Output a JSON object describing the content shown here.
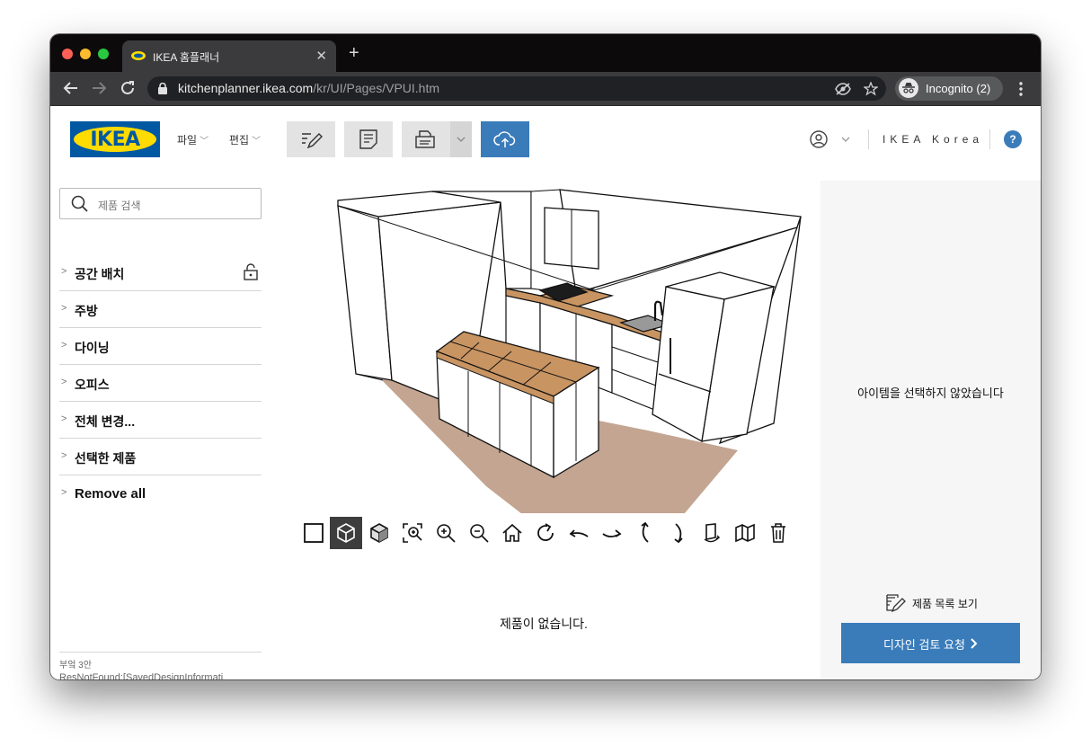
{
  "browser": {
    "tab_title": "IKEA 홈플래너",
    "tab_close": "✕",
    "new_tab": "+",
    "url_host": "kitchenplanner.ikea.com",
    "url_path": "/kr/UI/Pages/VPUI.htm",
    "incognito_label": "Incognito (2)"
  },
  "header": {
    "logo_text": "IKEA",
    "menu_file": "파일",
    "menu_edit": "편집",
    "store": "IKEA Korea",
    "help": "?"
  },
  "sidebar": {
    "search_placeholder": "제품 검색",
    "categories": [
      "공간 배치",
      "주방",
      "다이닝",
      "오피스",
      "전체 변경...",
      "선택한 제품",
      "Remove all"
    ],
    "footer_label": "부엌 3안",
    "footer_error": "ResNotFound:[SavedDesignInformati"
  },
  "viewer": {
    "no_products": "제품이 없습니다."
  },
  "right_panel": {
    "no_selection": "아이템을 선택하지 않았습니다",
    "product_list": "제품 목록 보기",
    "review_button": "디자인 검토 요청"
  },
  "colors": {
    "ikea_blue": "#0058a3",
    "ikea_yellow": "#ffdb00",
    "accent": "#3a7cba",
    "floor": "#c3a591",
    "counter": "#c89462"
  },
  "icons": {
    "view_tools": [
      "2d-view-icon",
      "3d-view-icon",
      "3d-solid-icon",
      "zoom-fit-icon",
      "zoom-in-icon",
      "zoom-out-icon",
      "home-view-icon",
      "rotate-icon",
      "turn-left-icon",
      "turn-right-icon",
      "tilt-up-icon",
      "tilt-down-icon",
      "walls-icon",
      "room-view-icon",
      "delete-icon"
    ]
  }
}
